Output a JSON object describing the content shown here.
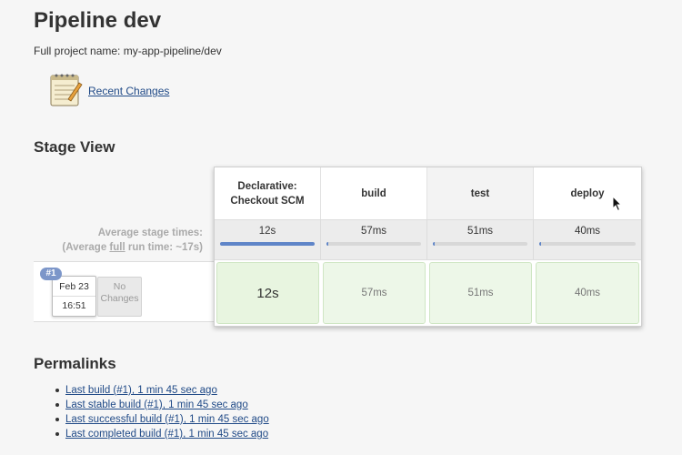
{
  "header": {
    "title": "Pipeline dev",
    "full_name": "Full project name: my-app-pipeline/dev"
  },
  "recent_changes": {
    "label": "Recent Changes",
    "icon": "notepad-icon"
  },
  "stage_view": {
    "title": "Stage View",
    "avg_label_line1": "Average stage times:",
    "avg_label_line2_prefix": "(Average ",
    "avg_label_line2_link": "full",
    "avg_label_line2_suffix": " run time: ~17s)",
    "stages": [
      {
        "name_line1": "Declarative:",
        "name_line2": "Checkout SCM",
        "avg": "12s",
        "run": "12s",
        "avg_fraction": 1.0
      },
      {
        "name_line1": "build",
        "name_line2": "",
        "avg": "57ms",
        "run": "57ms",
        "avg_fraction": 0.02
      },
      {
        "name_line1": "test",
        "name_line2": "",
        "avg": "51ms",
        "run": "51ms",
        "avg_fraction": 0.02
      },
      {
        "name_line1": "deploy",
        "name_line2": "",
        "avg": "40ms",
        "run": "40ms",
        "avg_fraction": 0.02
      }
    ],
    "run": {
      "badge": "#1",
      "date": "Feb 23",
      "time": "16:51",
      "changes_line1": "No",
      "changes_line2": "Changes"
    }
  },
  "permalinks": {
    "title": "Permalinks",
    "items": [
      "Last build (#1), 1 min 45 sec ago",
      "Last stable build (#1), 1 min 45 sec ago",
      "Last successful build (#1), 1 min 45 sec ago",
      "Last completed build (#1), 1 min 45 sec ago"
    ]
  },
  "colors": {
    "link": "#204a87",
    "success_bg": "#edf7e8",
    "bar": "#5f85c8"
  }
}
